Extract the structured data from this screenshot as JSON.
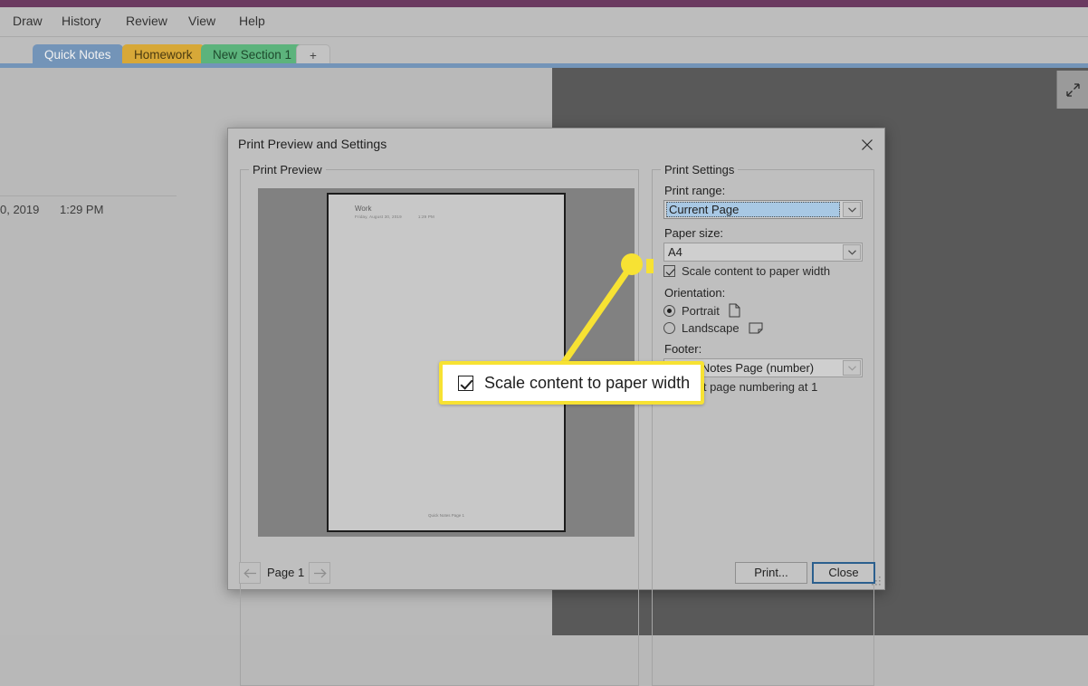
{
  "app": {
    "menu_items": [
      "Draw",
      "History",
      "Review",
      "View",
      "Help"
    ],
    "nav_back_icon": "chevron-left-dropdown-icon",
    "expand_icon": "expand-diagonal-icon",
    "tabs": [
      {
        "label": "Quick Notes",
        "color": "#7394b8"
      },
      {
        "label": "Homework",
        "color": "#d7a838"
      },
      {
        "label": "New Section 1",
        "color": "#5cb37c"
      }
    ],
    "add_tab_label": "+"
  },
  "note_background": {
    "date": "0, 2019",
    "time": "1:29 PM"
  },
  "dialog": {
    "title": "Print Preview and Settings",
    "close_icon": "close-icon",
    "preview_group_label": "Print Preview",
    "settings_group_label": "Print Settings",
    "preview_page": {
      "title": "Work",
      "date": "Friday, August 30, 2019",
      "time": "1:29 PM",
      "footer": "Quick Notes Page 1"
    },
    "settings": {
      "print_range_label": "Print range:",
      "print_range_value": "Current Page",
      "paper_size_label": "Paper size:",
      "paper_size_value": "A4",
      "scale_checkbox_label": "Scale content to paper width",
      "scale_checkbox_checked": true,
      "orientation_label": "Orientation:",
      "orientation_portrait": "Portrait",
      "orientation_landscape": "Landscape",
      "orientation_selected": "Portrait",
      "footer_label": "Footer:",
      "footer_value": "Quick Notes Page (number)",
      "start_numbering_label": "Start page numbering at 1",
      "start_numbering_checked": true
    },
    "footer_bar": {
      "prev_icon": "arrow-left-icon",
      "next_icon": "arrow-right-icon",
      "page_indicator": "Page 1",
      "print_button": "Print...",
      "close_button": "Close"
    }
  },
  "annotation": {
    "callout_text": "Scale content to paper width",
    "callout_checked": true,
    "highlight_color": "#f7e233"
  }
}
